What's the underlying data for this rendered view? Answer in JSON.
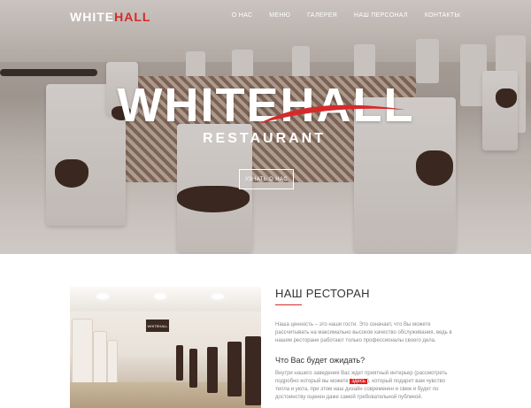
{
  "header": {
    "brand_prefix": "WHITE",
    "brand_suffix": "HALL",
    "nav": [
      "О НАС",
      "МЕНЮ",
      "ГАЛЕРЕЯ",
      "НАШ ПЕРСОНАЛ",
      "КОНТАКТЫ"
    ]
  },
  "hero": {
    "logo_word": "WHITEHALL",
    "logo_sub": "RESTAURANT",
    "cta_label": "УЗНАТЬ О НАС"
  },
  "about": {
    "title": "НАШ РЕСТОРАН",
    "photo_sign": "WHITEHALL",
    "p1": "Наша ценность – это наши гости. Это означает, что Вы можете рассчитывать на максимально высокое качество обслуживания, ведь в нашем ресторане работают только профессионалы своего дела.",
    "q_title": "Что Вас будет ожидать?",
    "p2_before": "Внутри нашего заведения Вас ждет приятный интерьер (рассмотреть подробно который вы можете ",
    "p2_link": "здесь",
    "p2_after": "), который подарит вам чувство тепла и уюта, при этом наш дизайн современен и свеж и будет по достоинству оценен даже самой требовательной публикой."
  },
  "colors": {
    "accent": "#d62a2a"
  }
}
